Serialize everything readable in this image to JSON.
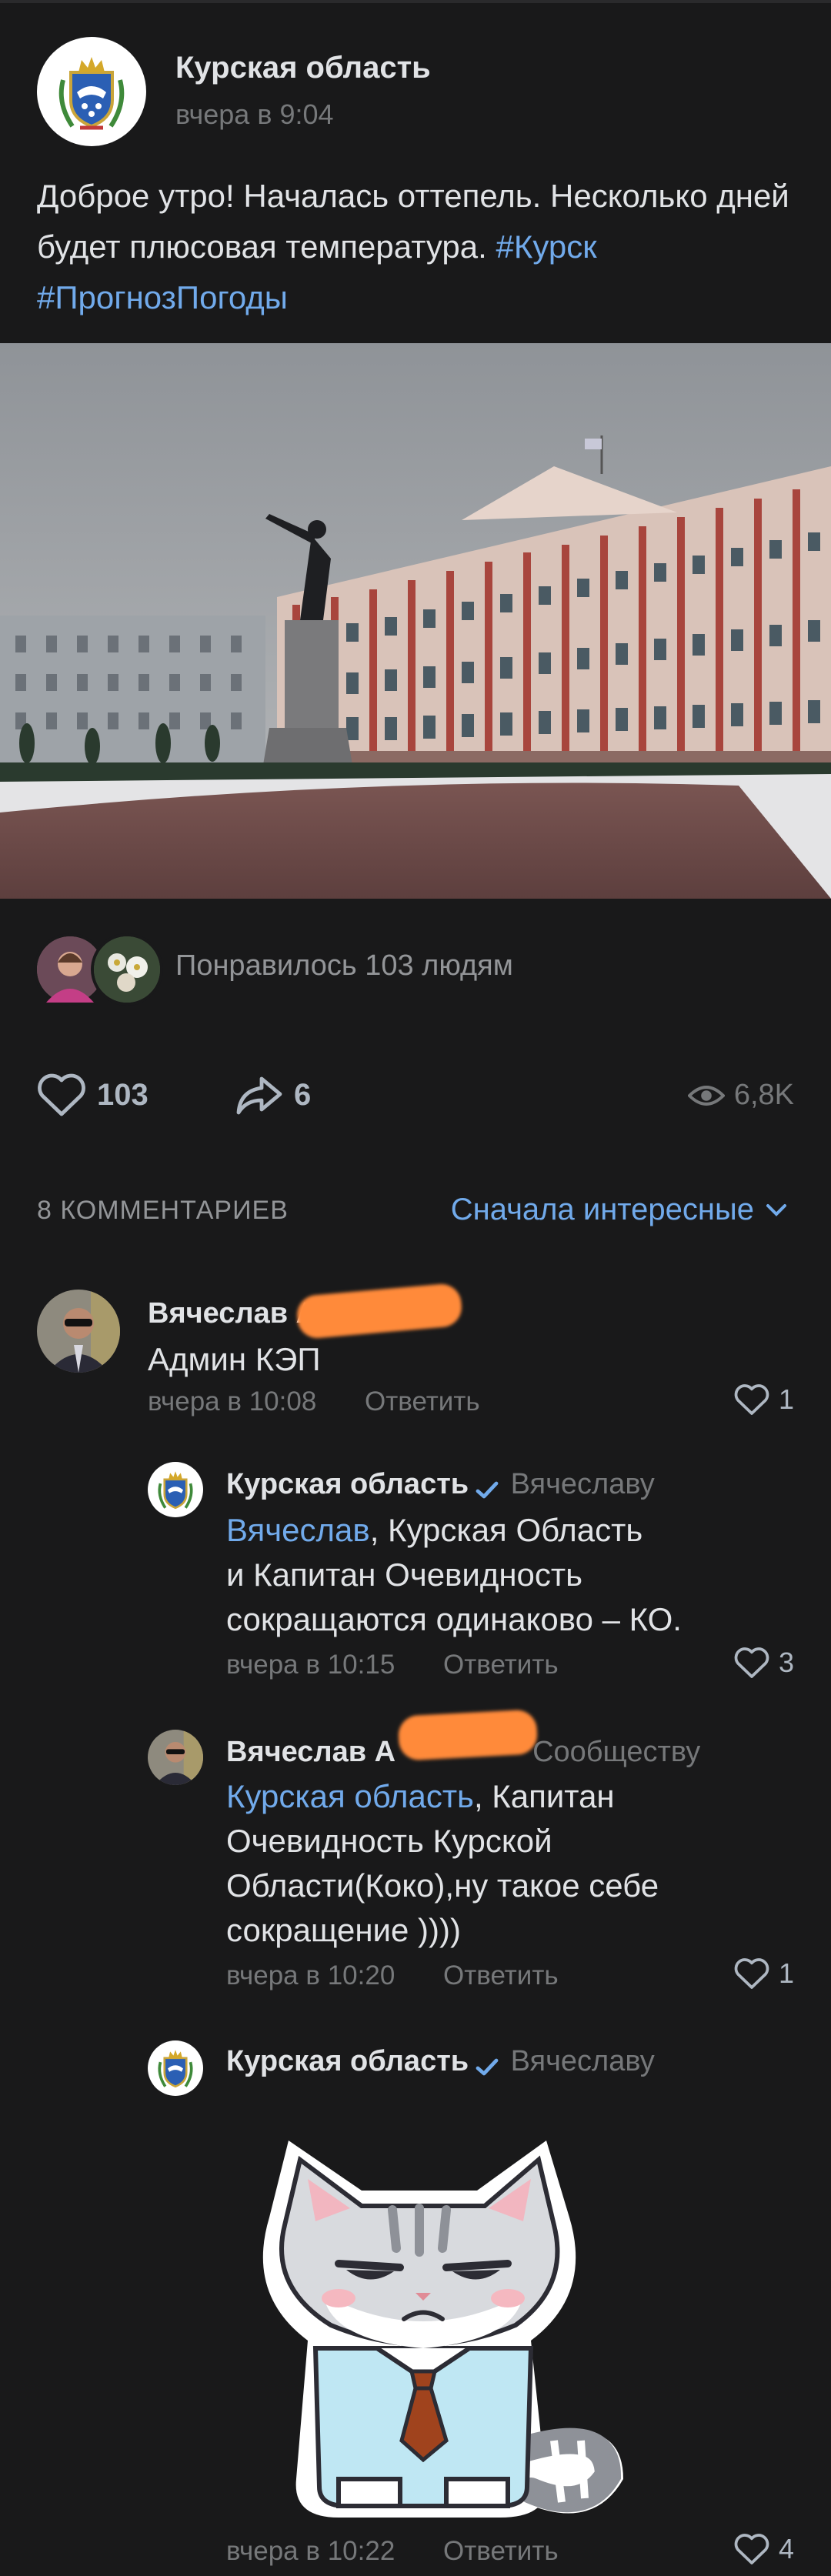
{
  "post": {
    "author": "Курская область",
    "time": "вчера в 9:04",
    "text_plain": "Доброе утро! Началась оттепель. Несколько дней будет плюсовая температура. ",
    "hashtag1": "#Курск",
    "hashtag2": "#ПрогнозПогоды",
    "liked_by_text": "Понравилось 103 людям",
    "likes": "103",
    "shares": "6",
    "views": "6,8K"
  },
  "comments_header": {
    "count_label": "8 КОММЕНТАРИЕВ",
    "sort_label": "Сначала интересные"
  },
  "comments": [
    {
      "author": "Вячеслав А",
      "text": "Админ КЭП",
      "time": "вчера в 10:08",
      "reply": "Ответить",
      "likes": "1"
    },
    {
      "author": "Курская область",
      "to": "Вячеславу",
      "mention": "Вячеслав",
      "text_line1": ", Курская Область",
      "text_line2": "и Капитан Очевидность",
      "text_line3": "сокращаются одинаково – КО.",
      "time": "вчера в 10:15",
      "reply": "Ответить",
      "likes": "3"
    },
    {
      "author": "Вячеслав А",
      "to": "Сообществу",
      "mention": "Курская область",
      "text_line1": ", Капитан",
      "text_line2": "Очевидность Курской",
      "text_line3": "Области(Коко),ну такое себе",
      "text_line4": "сокращение ))))",
      "time": "вчера в 10:20",
      "reply": "Ответить",
      "likes": "1"
    },
    {
      "author": "Курская область",
      "to": "Вячеславу",
      "sticker": "grumpy-cat-tie-sticker",
      "time": "вчера в 10:22",
      "reply": "Ответить",
      "likes": "4"
    }
  ],
  "colors": {
    "background": "#19191a",
    "link": "#71aaeb",
    "secondary_text": "#76787a",
    "censor_blob": "#ff8a3a"
  }
}
